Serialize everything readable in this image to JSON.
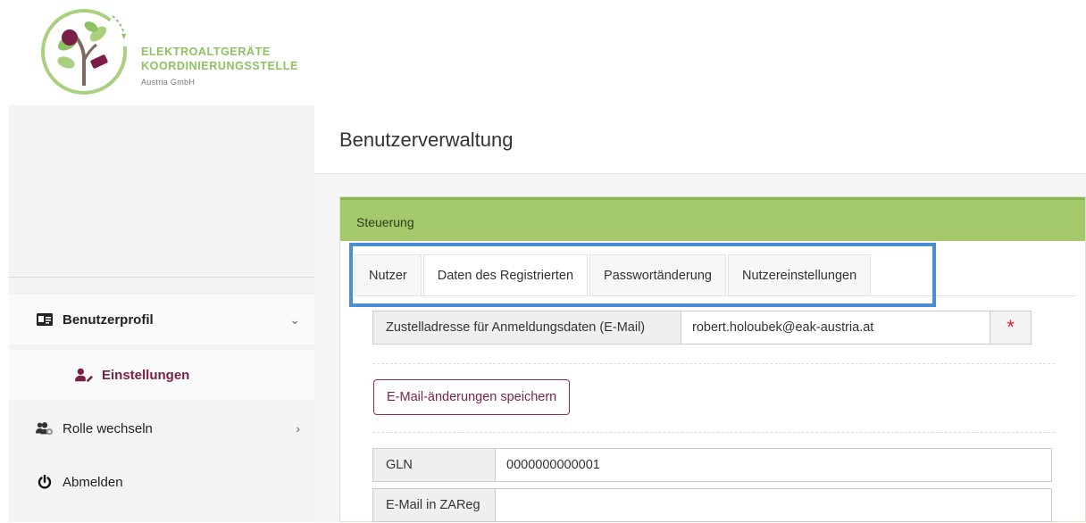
{
  "brand": {
    "line1": "ELEKTROALTGERÄTE",
    "line2": "KOORDINIERUNGSSTELLE",
    "line3": "Austria GmbH",
    "color_green": "#8dc263",
    "color_plum": "#7b1f4a"
  },
  "sidebar": {
    "profile": {
      "label": "Benutzerprofil",
      "icon": "id-card-icon",
      "expanded": true
    },
    "settings": {
      "label": "Einstellungen",
      "icon": "user-edit-icon",
      "active": true
    },
    "role": {
      "label": "Rolle wechseln",
      "icon": "users-cog-icon"
    },
    "logout": {
      "label": "Abmelden",
      "icon": "power-icon"
    }
  },
  "page": {
    "title": "Benutzerverwaltung"
  },
  "card": {
    "header": "Steuerung",
    "header_color": "#a3c96b",
    "tabs": [
      {
        "label": "Nutzer",
        "active": false
      },
      {
        "label": "Daten des Registrierten",
        "active": true
      },
      {
        "label": "Passwortänderung",
        "active": false
      },
      {
        "label": "Nutzereinstellungen",
        "active": false
      }
    ],
    "highlight_color": "#4a8fd4"
  },
  "form": {
    "email_label": "Zustelladresse für Anmeldungsdaten (E-Mail)",
    "email_value": "robert.holoubek@eak-austria.at",
    "required_mark": "*",
    "save_button": "E-Mail-änderungen speichern",
    "gln_label": "GLN",
    "gln_value": "0000000000001",
    "zareg_label": "E-Mail in ZAReg",
    "zareg_value": ""
  }
}
